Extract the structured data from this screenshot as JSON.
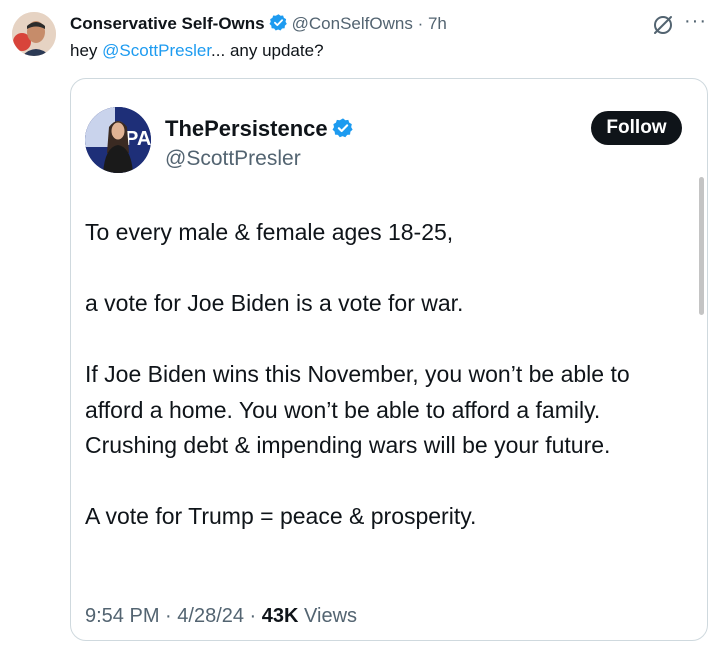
{
  "outer_tweet": {
    "author_name": "Conservative Self-Owns",
    "handle": "@ConSelfOwns",
    "separator": "·",
    "time": "7h",
    "text_prefix": "hey ",
    "mention": "@ScottPresler",
    "text_suffix": "... any update?",
    "more": "···"
  },
  "quoted_tweet": {
    "author_name": "ThePersistence",
    "handle": "@ScottPresler",
    "follow_label": "Follow",
    "paragraphs": [
      "To every male & female ages 18-25,",
      "a vote for Joe Biden is a vote for war.",
      "If Joe Biden wins this November, you won’t be able to afford a home. You won’t be able to afford a family. Crushing debt & impending wars will be your future.",
      "A vote for Trump = peace & prosperity."
    ],
    "time": "9:54 PM",
    "sep1": " · ",
    "date": "4/28/24",
    "sep2": " · ",
    "views_count": "43K",
    "views_label": " Views"
  },
  "colors": {
    "accent": "#1d9bf0",
    "muted": "#536471",
    "text": "#0f1419",
    "border": "#cfd9de"
  }
}
